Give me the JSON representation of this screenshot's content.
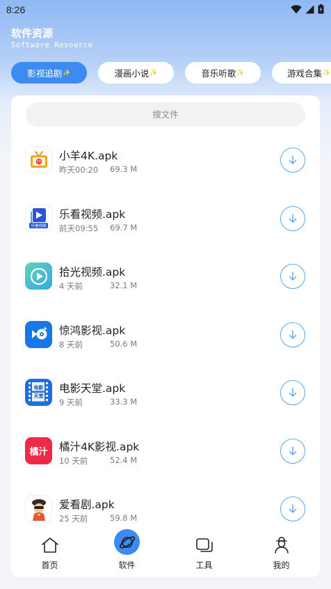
{
  "status_bar": {
    "time": "8:26",
    "icons": [
      "wifi-icon",
      "signal-icon",
      "battery-icon"
    ]
  },
  "header": {
    "title": "软件资源",
    "subtitle": "Software Resource"
  },
  "tabs": [
    {
      "label": "影视追剧",
      "active": true
    },
    {
      "label": "漫画小说",
      "active": false
    },
    {
      "label": "音乐听歌",
      "active": false
    },
    {
      "label": "游戏合集",
      "active": false
    }
  ],
  "search": {
    "placeholder": "搜文件"
  },
  "files": [
    {
      "name": "小羊4K.apk",
      "time": "昨天00:20",
      "size": "69.3 M",
      "icon": "tv-app-icon"
    },
    {
      "name": "乐看视频.apk",
      "time": "前天09:55",
      "size": "69.7 M",
      "icon": "play-app-icon",
      "icon_caption": "乐看视频"
    },
    {
      "name": "拾光视频.apk",
      "time": "4 天前",
      "size": "32.1 M",
      "icon": "circle-play-app-icon"
    },
    {
      "name": "惊鸿影视.apk",
      "time": "8 天前",
      "size": "50.6 M",
      "icon": "disc-app-icon"
    },
    {
      "name": "电影天堂.apk",
      "time": "9 天前",
      "size": "33.3 M",
      "icon": "film-app-icon",
      "icon_caption_top": "电影",
      "icon_caption_bottom": "天堂"
    },
    {
      "name": "橘汁4K影视.apk",
      "time": "10 天前",
      "size": "52.4 M",
      "icon": "orange-juice-app-icon",
      "icon_caption": "橘汁"
    },
    {
      "name": "爱看剧.apk",
      "time": "25 天前",
      "size": "59.8 M",
      "icon": "character-app-icon"
    }
  ],
  "bottom_nav": [
    {
      "label": "首页",
      "icon": "home-icon",
      "active": false
    },
    {
      "label": "软件",
      "icon": "planet-icon",
      "active": true
    },
    {
      "label": "工具",
      "icon": "tools-icon",
      "active": false
    },
    {
      "label": "我的",
      "icon": "profile-icon",
      "active": false
    }
  ],
  "colors": {
    "accent": "#3d8af0",
    "download_ring": "#5aa6ea",
    "background": "#f2f4f8"
  }
}
